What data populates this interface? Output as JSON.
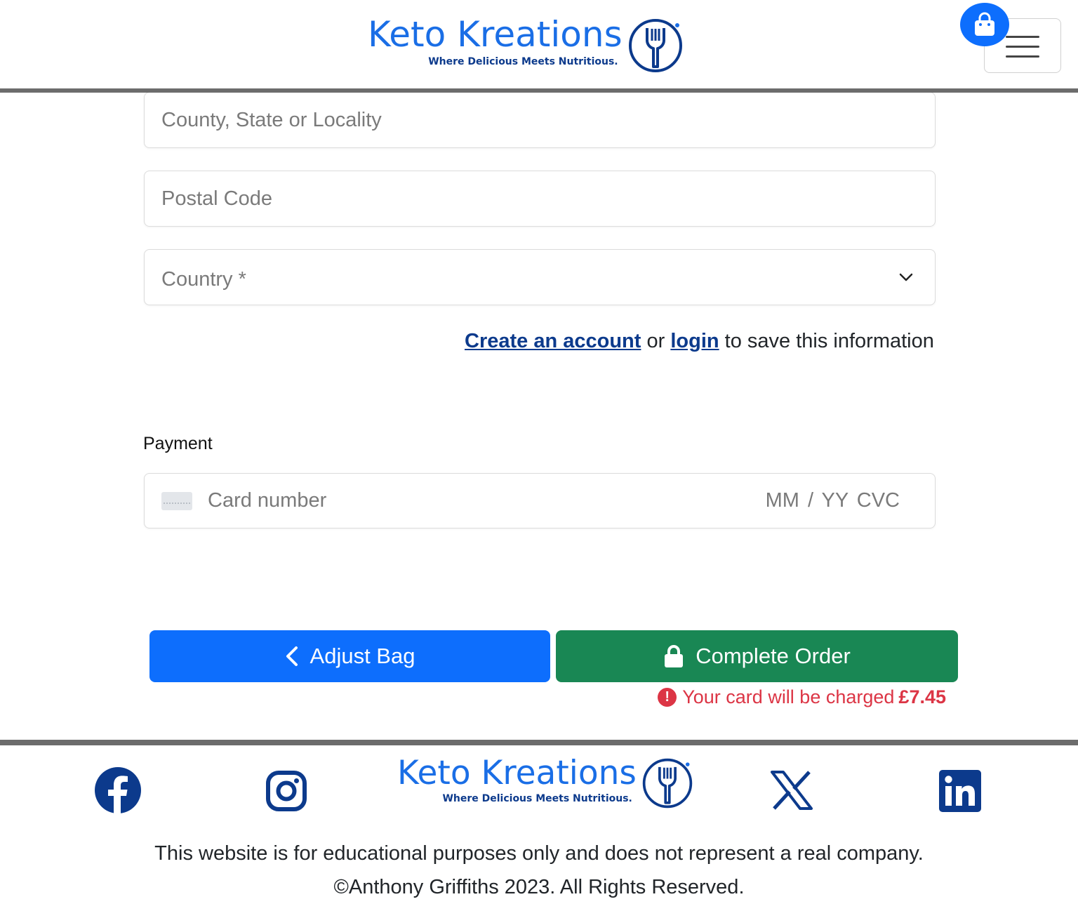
{
  "header": {
    "logo_title": "Keto Kreations",
    "logo_tagline": "Where Delicious Meets Nutritious.",
    "bag_icon": "shopping-bag-icon",
    "menu_icon": "hamburger-menu-icon"
  },
  "form": {
    "county_placeholder": "County, State or Locality",
    "postal_placeholder": "Postal Code",
    "country_placeholder": "Country *",
    "account_prompt": {
      "create_link": "Create an account",
      "or_text": "or",
      "login_link": "login",
      "suffix": "to save this information"
    }
  },
  "payment": {
    "label": "Payment",
    "card_placeholder": "Card number",
    "expiry_cvc_placeholder": "MM / YY  CVC"
  },
  "actions": {
    "adjust_bag_label": "Adjust Bag",
    "complete_order_label": "Complete Order",
    "charge_text": "Your card will be charged",
    "charge_amount": "£7.45"
  },
  "footer": {
    "logo_title": "Keto Kreations",
    "logo_tagline": "Where Delicious Meets Nutritious.",
    "social_icons": [
      "facebook-icon",
      "instagram-icon",
      "x-twitter-icon",
      "linkedin-icon"
    ],
    "disclaimer": "This website is for educational purposes only and does not represent a real company.",
    "copyright": "©Anthony Griffiths 2023. All Rights Reserved."
  },
  "colors": {
    "brand_blue": "#1a6ee6",
    "brand_navy": "#0c3a8c",
    "primary_button": "#0d6efd",
    "success_button": "#198754",
    "danger_text": "#dc3545"
  }
}
